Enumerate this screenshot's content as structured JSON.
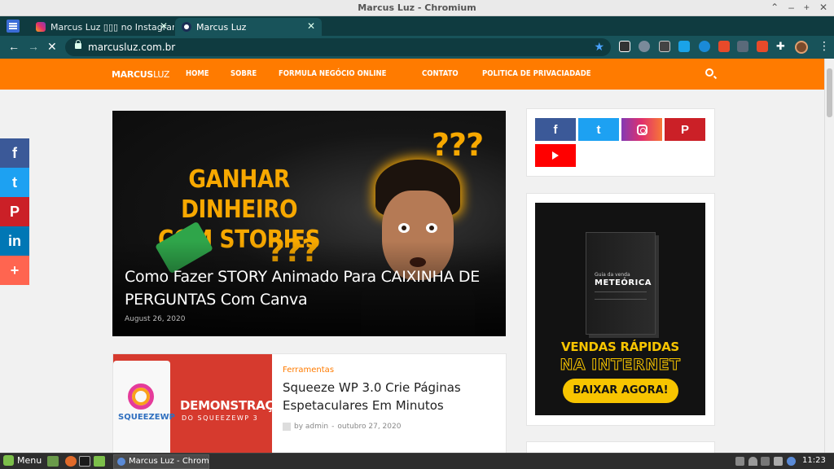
{
  "window": {
    "title": "Marcus Luz - Chromium",
    "controls": [
      "⌃",
      "–",
      "+",
      "✕"
    ]
  },
  "tabs": [
    {
      "label": "Marcus Luz ▯▯▯ no Instagram:",
      "active": false
    },
    {
      "label": "Marcus Luz",
      "active": true
    }
  ],
  "toolbar": {
    "url": "marcusluz.com.br"
  },
  "site": {
    "logo_bold": "MARCUS",
    "logo_light": "LUZ",
    "menu": [
      "HOME",
      "SOBRE",
      "FORMULA NEGÓCIO ONLINE",
      "CONTATO",
      "POLITICA DE PRIVACIADADE"
    ]
  },
  "share_bar": [
    "f",
    "t",
    "P",
    "in",
    "+"
  ],
  "hero": {
    "headline_line1": "GANHAR DINHEIRO",
    "headline_line2": "COM STORIES",
    "qmarks": "???",
    "title": "Como Fazer STORY Animado Para CAIXINHA DE PERGUNTAS Com Canva",
    "date": "August 26, 2020"
  },
  "article": {
    "thumb_brand": "SQUEEZEWP",
    "thumb_text": "DEMONSTRAÇ",
    "thumb_sub": "DO SQUEEZEWP 3",
    "category": "Ferramentas",
    "title": "Squeeze WP 3.0 Crie Páginas Espetaculares Em Minutos",
    "author": "by admin",
    "date": "outubro 27, 2020"
  },
  "social": {
    "facebook": "f",
    "twitter": "t",
    "instagram": "instagram",
    "pinterest": "P",
    "youtube": "youtube"
  },
  "ad": {
    "book_small": "Guia da venda",
    "book_big": "METEÓRICA",
    "line1": "VENDAS RÁPIDAS",
    "line2": "NA INTERNET",
    "button": "BAIXAR AGORA!"
  },
  "taskbar": {
    "menu": "Menu",
    "task": "Marcus Luz - Chromi...",
    "time": "11:23"
  }
}
